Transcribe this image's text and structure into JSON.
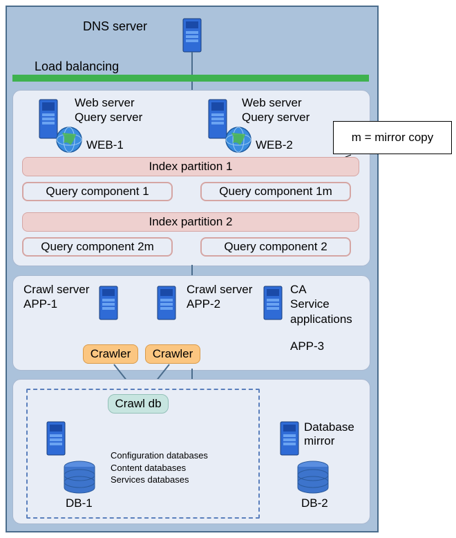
{
  "dns": {
    "label": "DNS server"
  },
  "load_balancing": {
    "label": "Load balancing"
  },
  "web_tier": {
    "ws1": {
      "role1": "Web server",
      "role2": "Query server",
      "name": "WEB-1"
    },
    "ws2": {
      "role1": "Web server",
      "role2": "Query server",
      "name": "WEB-2"
    },
    "idx1": "Index partition 1",
    "idx2": "Index partition 2",
    "qc1": "Query component 1",
    "qc1m": "Query component 1m",
    "qc2m": "Query component 2m",
    "qc2": "Query component 2"
  },
  "callout": {
    "text": "m = mirror copy"
  },
  "app_tier": {
    "app1": {
      "role": "Crawl server",
      "name": "APP-1"
    },
    "app2": {
      "role": "Crawl server",
      "name": "APP-2"
    },
    "app3": {
      "role1": "CA",
      "role2": "Service",
      "role3": "applications",
      "name": "APP-3"
    },
    "crawler1": "Crawler",
    "crawler2": "Crawler"
  },
  "db_tier": {
    "crawl_db": "Crawl db",
    "list1": "Configuration databases",
    "list2": "Content databases",
    "list3": "Services databases",
    "db1": "DB-1",
    "db2": "DB-2",
    "mirror": "Database mirror"
  }
}
